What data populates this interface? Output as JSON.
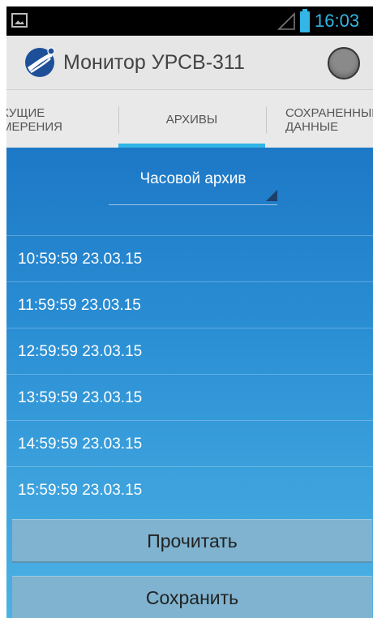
{
  "status_bar": {
    "time": "16:03",
    "battery_color": "#33b5e5",
    "icons": [
      "picture-icon",
      "signal-icon",
      "battery-icon"
    ]
  },
  "action_bar": {
    "title": "Монитор УРСВ-311",
    "logo_icon": "app-logo-icon",
    "action_icon": "status-circle-icon"
  },
  "tabs": [
    {
      "line1": "КУЩИЕ",
      "line2": "МЕРЕНИЯ"
    },
    {
      "line1": "АРХИВЫ",
      "line2": ""
    },
    {
      "line1": "СОХРАНЕННЫЕ",
      "line2": "ДАННЫЕ"
    }
  ],
  "accent_color": "#33b5e5",
  "archive_spinner": {
    "selected": "Часовой архив"
  },
  "records": [
    "10:59:59 23.03.15",
    "11:59:59 23.03.15",
    "12:59:59 23.03.15",
    "13:59:59 23.03.15",
    "14:59:59 23.03.15",
    "15:59:59 23.03.15"
  ],
  "buttons": {
    "read_label": "Прочитать",
    "save_label": "Сохранить"
  }
}
